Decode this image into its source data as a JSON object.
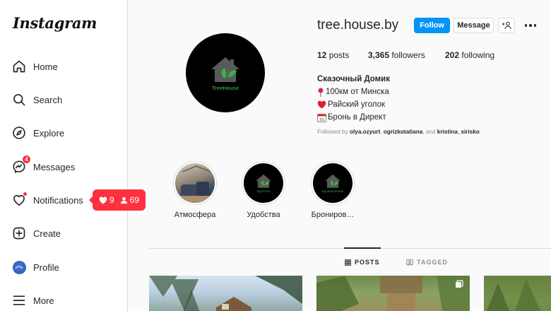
{
  "app": {
    "logo": "Instagram"
  },
  "sidebar": {
    "items": [
      {
        "label": "Home",
        "icon": "home-icon"
      },
      {
        "label": "Search",
        "icon": "search-icon"
      },
      {
        "label": "Explore",
        "icon": "explore-icon"
      },
      {
        "label": "Messages",
        "icon": "messages-icon",
        "badge": "4"
      },
      {
        "label": "Notifications",
        "icon": "heart-icon"
      },
      {
        "label": "Create",
        "icon": "create-icon"
      },
      {
        "label": "Profile",
        "icon": "avatar"
      },
      {
        "label": "More",
        "icon": "menu-icon"
      }
    ]
  },
  "notifications_popup": {
    "likes": "9",
    "followers": "69",
    "color": "#ff3040"
  },
  "profile": {
    "username": "tree.house.by",
    "avatar_text": "TreeHouse",
    "follow_label": "Follow",
    "message_label": "Message",
    "add_person_label": "+👤",
    "stats": {
      "posts_count": "12",
      "posts_label": "posts",
      "followers_count": "3,365",
      "followers_label": "followers",
      "following_count": "202",
      "following_label": "following"
    },
    "bio": {
      "name": "Сказочный Домик",
      "lines": [
        {
          "emoji": "📍",
          "text": "100км от Минска"
        },
        {
          "emoji": "❤️",
          "text": "Райский уголок"
        },
        {
          "emoji": "📅",
          "text": "Бронь в Директ"
        }
      ]
    },
    "followed_by": {
      "prefix": "Followed by",
      "user1": "olya.ozyurt",
      "separator": ",",
      "user2": "ogrizkotatiana",
      "and": ", and",
      "user3": "kristina_sirisko"
    }
  },
  "highlights": [
    {
      "label": "Атмосфера",
      "cover_text": ""
    },
    {
      "label": "Удобства",
      "cover_text": "Удобства"
    },
    {
      "label": "Брониров…",
      "cover_text": "Бронирование"
    }
  ],
  "tabs": [
    {
      "label": "POSTS",
      "active": true
    },
    {
      "label": "TAGGED",
      "active": false
    }
  ],
  "colors": {
    "accent": "#0095f6",
    "notification": "#ff3040",
    "logo_green": "#2f9a3a"
  }
}
